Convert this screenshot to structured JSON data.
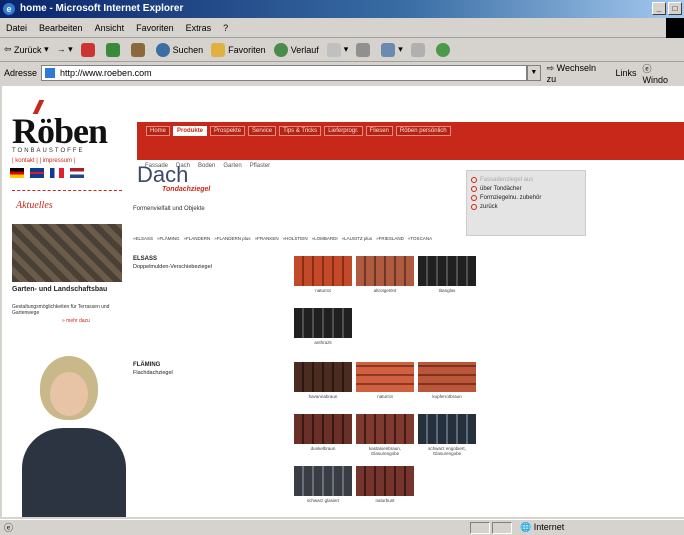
{
  "window": {
    "title": "home - Microsoft Internet Explorer",
    "controls": [
      "_",
      "□"
    ]
  },
  "menu": [
    "Datei",
    "Bearbeiten",
    "Ansicht",
    "Favoriten",
    "Extras",
    "?"
  ],
  "toolbar": {
    "back": "Zurück",
    "search": "Suchen",
    "favorites": "Favoriten",
    "history": "Verlauf"
  },
  "address": {
    "label": "Adresse",
    "url": "http://www.roeben.com",
    "go": "Wechseln zu",
    "links": "Links",
    "windows": "Windo"
  },
  "site": {
    "logo": "Röben",
    "logo_sub": "TONBAUSTOFFE",
    "top_links": "| kontakt |   | impressum |",
    "nav": [
      "Home",
      "Produkte",
      "Prospekte",
      "Service",
      "Tips & Tricks",
      "Lieferprogr.",
      "Fliesen",
      "Röben persönlich"
    ],
    "subnav": [
      "Fassade",
      "Dach",
      "Boden",
      "Garten",
      "Pflaster"
    ],
    "news": {
      "title": "Aktuelles",
      "headline": "Garten- und Landschaftsbau",
      "text": "Gestaltungsmöglichkeiten für Terrassen und Gartenwege",
      "more": "» mehr dazu"
    },
    "page": {
      "title": "Dach",
      "subtitle": "Tondachziegel",
      "description": "Formenvielfalt und Objekte",
      "models": [
        "»ELSASS",
        "»FLÄMING",
        "»FLANDERN",
        "»FLANDERN plus",
        "»FRANKEN",
        "»HOLSTEIN",
        "»LOMBARDI",
        "»LAUSITZ plus",
        "»FRIESLAND",
        "»TOSCANA"
      ]
    },
    "infobox": {
      "items": [
        {
          "label": "Fassadenziegel aus",
          "dim": true
        },
        {
          "label": "über Tondächer",
          "dim": false
        },
        {
          "label": "Formziegelnu. zubehör",
          "dim": false
        },
        {
          "label": "zurück",
          "dim": false
        }
      ]
    },
    "products": [
      {
        "name": "ELSASS",
        "sub": "Doppelmulden-Verschiebeziegel",
        "tiles": [
          {
            "caption": "naturrot"
          },
          {
            "caption": "altrotgetönt"
          },
          {
            "caption": "titanglas"
          },
          {
            "caption": "anthrazit"
          }
        ]
      },
      {
        "name": "FLÄMING",
        "sub": "Flachdachziegel",
        "tiles": [
          {
            "caption": "havannabraun"
          },
          {
            "caption": "naturrot"
          },
          {
            "caption": "kupferrotbraun"
          },
          {
            "caption": "dunkelbraun"
          },
          {
            "caption": "kastanienbraun, Glasurengobe"
          },
          {
            "caption": "schwarz engobiert, Glasurengobe"
          },
          {
            "caption": "schwarz glasiert"
          },
          {
            "caption": "naturbunt"
          }
        ]
      }
    ]
  },
  "status": {
    "left": "",
    "zone": "Internet"
  }
}
